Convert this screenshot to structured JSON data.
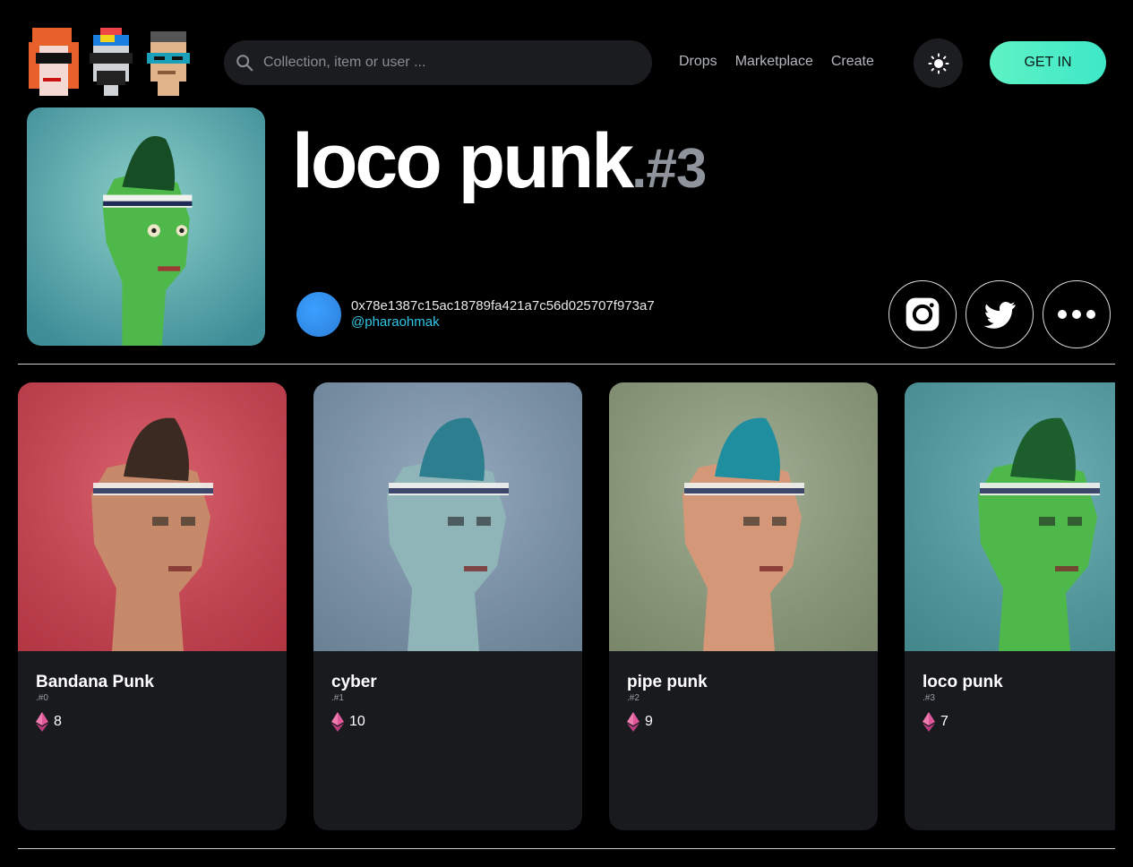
{
  "header": {
    "search_placeholder": "Collection, item or user ...",
    "nav": [
      "Drops",
      "Marketplace",
      "Create"
    ],
    "cta": "GET IN"
  },
  "hero": {
    "title": "loco punk",
    "suffix": ".#3",
    "owner_address": "0x78e1387c15ac18789fa421a7c56d025707f973a7",
    "owner_handle": "@pharaohmak"
  },
  "cards": [
    {
      "name": "Bandana Punk",
      "number": ".#0",
      "price": "8",
      "bg": "#d2404f",
      "skin": "#c68a6a",
      "hair": "#3b2a22"
    },
    {
      "name": "cyber",
      "number": ".#1",
      "price": "10",
      "bg": "#7e98b0",
      "skin": "#8fb5b8",
      "hair": "#2d7f8f"
    },
    {
      "name": "pipe punk",
      "number": ".#2",
      "price": "9",
      "bg": "#8f9f7e",
      "skin": "#d49878",
      "hair": "#1f8fa0"
    },
    {
      "name": "loco punk",
      "number": ".#3",
      "price": "7",
      "bg": "#4fa0a6",
      "skin": "#4fb84a",
      "hair": "#1c5e2c"
    }
  ],
  "colors": {
    "accent": "#49edc6",
    "handle": "#31c6e6",
    "eth": "#e0579a"
  }
}
